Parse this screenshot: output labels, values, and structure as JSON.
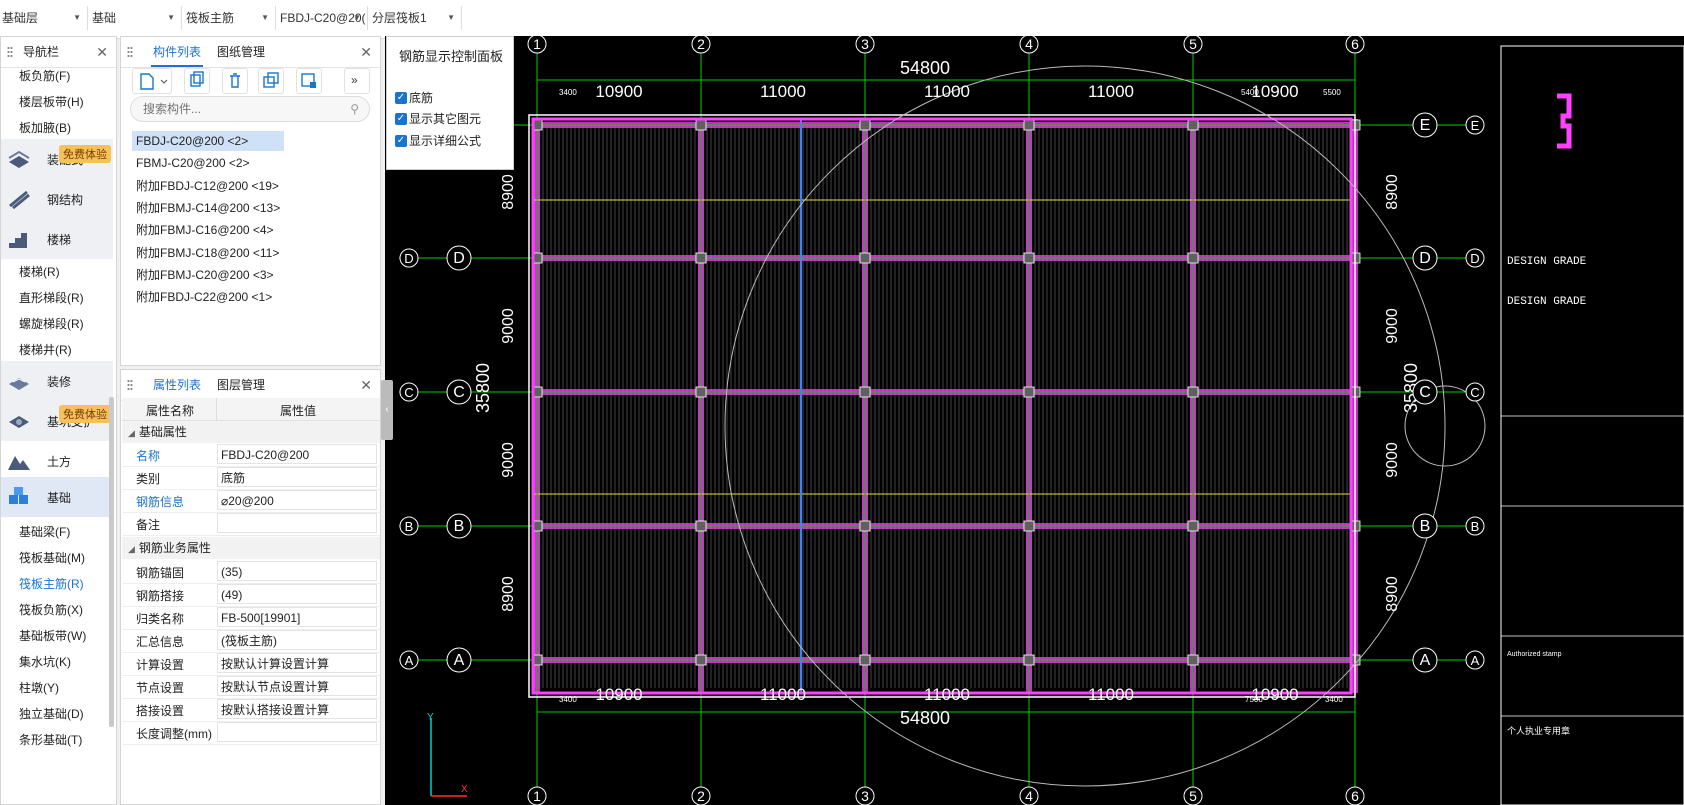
{
  "topbar": {
    "dropdowns": [
      "基础层",
      "基础",
      "筏板主筋",
      "FBDJ-C20@20(",
      "分层筏板1"
    ]
  },
  "nav": {
    "title": "导航栏",
    "items_top": [
      "板负筋(F)",
      "楼层板带(H)",
      "板加腋(B)"
    ],
    "cats": [
      {
        "label": "装配式",
        "badge": "免费体验"
      },
      {
        "label": "钢结构"
      },
      {
        "label": "楼梯"
      }
    ],
    "stair_items": [
      "楼梯(R)",
      "直形梯段(R)",
      "螺旋梯段(R)",
      "楼梯井(R)"
    ],
    "cats2": [
      {
        "label": "装修"
      },
      {
        "label": "基坑支护",
        "badge": "免费体验"
      },
      {
        "label": "土方"
      },
      {
        "label": "基础"
      }
    ],
    "foundation_items": [
      "基础梁(F)",
      "筏板基础(M)",
      "筏板主筋(R)",
      "筏板负筋(X)",
      "基础板带(W)",
      "集水坑(K)",
      "柱墩(Y)",
      "独立基础(D)",
      "条形基础(T)"
    ],
    "active_item": "筏板主筋(R)"
  },
  "components": {
    "tabs": [
      "构件列表",
      "图纸管理"
    ],
    "search_placeholder": "搜索构件...",
    "items": [
      "FBDJ-C20@200 <2>",
      "FBMJ-C20@200 <2>",
      "附加FBDJ-C12@200 <19>",
      "附加FBMJ-C14@200 <13>",
      "附加FBMJ-C16@200 <4>",
      "附加FBMJ-C18@200 <11>",
      "附加FBMJ-C20@200 <3>",
      "附加FBDJ-C22@200 <1>"
    ]
  },
  "properties": {
    "tabs": [
      "属性列表",
      "图层管理"
    ],
    "col_name": "属性名称",
    "col_value": "属性值",
    "group1": "基础属性",
    "rows1": [
      {
        "k": "名称",
        "v": "FBDJ-C20@200",
        "blue": true
      },
      {
        "k": "类别",
        "v": "底筋",
        "blue": false
      },
      {
        "k": "钢筋信息",
        "v": "⌀20@200",
        "blue": true
      },
      {
        "k": "备注",
        "v": "",
        "blue": false
      }
    ],
    "group2": "钢筋业务属性",
    "rows2": [
      {
        "k": "钢筋锚固",
        "v": "(35)"
      },
      {
        "k": "钢筋搭接",
        "v": "(49)"
      },
      {
        "k": "归类名称",
        "v": "FB-500[19901]"
      },
      {
        "k": "汇总信息",
        "v": "(筏板主筋)"
      },
      {
        "k": "计算设置",
        "v": "按默认计算设置计算"
      },
      {
        "k": "节点设置",
        "v": "按默认节点设置计算"
      },
      {
        "k": "搭接设置",
        "v": "按默认搭接设置计算"
      },
      {
        "k": "长度调整(mm)",
        "v": ""
      }
    ]
  },
  "control_panel": {
    "title": "钢筋显示控制面板",
    "options": [
      "底筋",
      "显示其它图元",
      "显示详细公式"
    ]
  },
  "drawing": {
    "col_labels": [
      "1",
      "2",
      "3",
      "4",
      "5",
      "6"
    ],
    "row_labels": [
      "E",
      "D",
      "C",
      "B",
      "A"
    ],
    "top_total": "54800",
    "bottom_total": "54800",
    "spans_top": [
      "10900",
      "11000",
      "11000",
      "11000",
      "10900"
    ],
    "spans_bottom": [
      "10900",
      "11000",
      "11000",
      "11000",
      "10900"
    ],
    "left_total": "35800",
    "right_total": "35800",
    "spans_left": [
      "8900",
      "9000",
      "9000",
      "8900"
    ],
    "spans_right": [
      "8900",
      "9000",
      "9000",
      "8900"
    ],
    "small_dims": [
      "3400",
      "3400",
      "5400",
      "5500",
      "7500",
      "3400"
    ],
    "titleblock": [
      "DESIGN GRADE",
      "DESIGN GRADE",
      "Authorized stamp",
      "个人执业专用章"
    ],
    "colors": {
      "bg": "#000000",
      "grid": "#00d000",
      "axis_label": "#ffffff",
      "slab": "#ff40ff",
      "rebar": "#e0e0e0"
    }
  }
}
